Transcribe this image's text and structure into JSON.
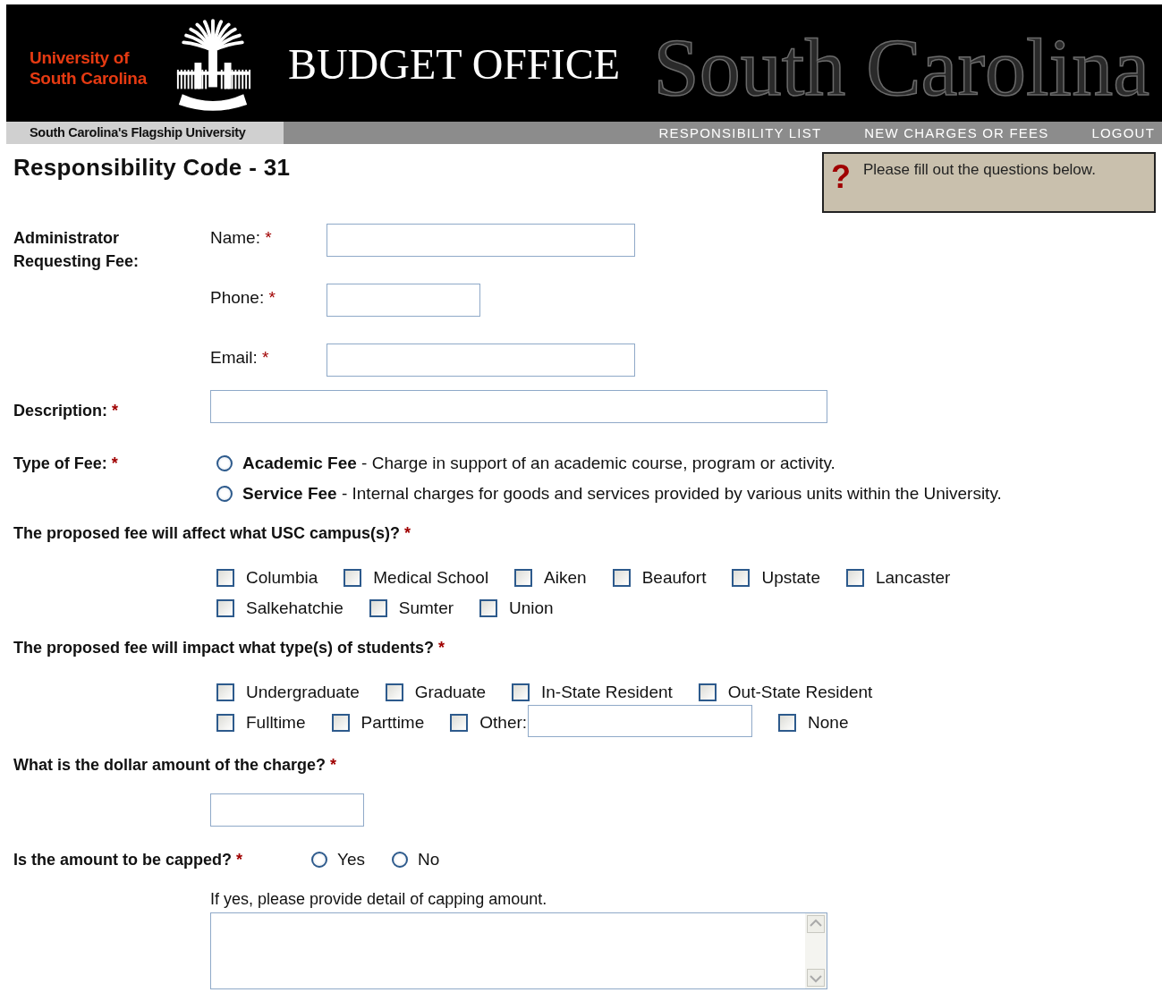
{
  "header": {
    "university_name": [
      "University of",
      "South Carolina"
    ],
    "banner_script": "South Carolina",
    "office_title": "BUDGET OFFICE",
    "tagline": "South Carolina's Flagship University",
    "nav": [
      {
        "label": "RESPONSIBILITY LIST"
      },
      {
        "label": "NEW CHARGES OR FEES"
      },
      {
        "label": "LOGOUT"
      }
    ]
  },
  "page_title": "Responsibility Code - 31",
  "notice": {
    "icon": "?",
    "text": "Please fill out the questions below."
  },
  "sections": [
    {
      "kind": "contact",
      "label": "Administrator Requesting Fee:",
      "fields": [
        {
          "kind": "long",
          "label": "Name:",
          "required_mark": "*"
        },
        {
          "kind": "short",
          "label": "Phone:",
          "required_mark": "*"
        },
        {
          "kind": "long",
          "label": "Email:",
          "required_mark": "*"
        }
      ]
    },
    {
      "kind": "text",
      "label": "Description:",
      "required_mark": "*"
    },
    {
      "kind": "radio-list",
      "label": "Type of Fee:",
      "required_mark": "*",
      "options": [
        {
          "text": "**Academic Fee** - Charge in support of an academic course, program or activity.",
          "selected": false
        },
        {
          "text": "**Service Fee** - Internal charges for goods and services provided by various units within the University.",
          "selected": false
        }
      ]
    },
    {
      "kind": "checkbox-grid",
      "label": "The proposed fee will affect what USC campus(s)?",
      "required_mark": "*",
      "rows": [
        [
          {
            "kind": "plain",
            "label": "Columbia",
            "checked": false
          },
          {
            "kind": "plain",
            "label": "Medical School",
            "checked": false
          },
          {
            "kind": "plain",
            "label": "Aiken",
            "checked": false
          },
          {
            "kind": "plain",
            "label": "Beaufort",
            "checked": false
          },
          {
            "kind": "plain",
            "label": "Upstate",
            "checked": false
          },
          {
            "kind": "plain",
            "label": "Lancaster",
            "checked": false
          }
        ],
        [
          {
            "kind": "plain",
            "label": "Salkehatchie",
            "checked": false
          },
          {
            "kind": "plain",
            "label": "Sumter",
            "checked": false
          },
          {
            "kind": "plain",
            "label": "Union",
            "checked": false
          }
        ]
      ]
    },
    {
      "kind": "checkbox-grid",
      "label": "The proposed fee will impact what type(s) of students?",
      "required_mark": "*",
      "rows": [
        [
          {
            "kind": "plain",
            "label": "Undergraduate",
            "checked": false
          },
          {
            "kind": "plain",
            "label": "Graduate",
            "checked": false
          },
          {
            "kind": "plain",
            "label": "In-State Resident",
            "checked": false
          },
          {
            "kind": "plain",
            "label": "Out-State Resident",
            "checked": false
          }
        ],
        [
          {
            "kind": "plain",
            "label": "Fulltime",
            "checked": false
          },
          {
            "kind": "plain",
            "label": "Parttime",
            "checked": false
          },
          {
            "kind": "other",
            "label": "Other:",
            "checked": false
          },
          {
            "kind": "plain",
            "label": "None",
            "checked": false
          }
        ]
      ]
    },
    {
      "kind": "amount",
      "label": "What is the dollar amount of the charge?",
      "required_mark": "*"
    },
    {
      "kind": "radio-inline",
      "label": "Is the amount to be capped?",
      "required_mark": "*",
      "options": [
        {
          "text": "Yes",
          "selected": false
        },
        {
          "text": "No",
          "selected": false
        }
      ],
      "detail_label": "If yes, please provide detail of capping amount."
    }
  ]
}
